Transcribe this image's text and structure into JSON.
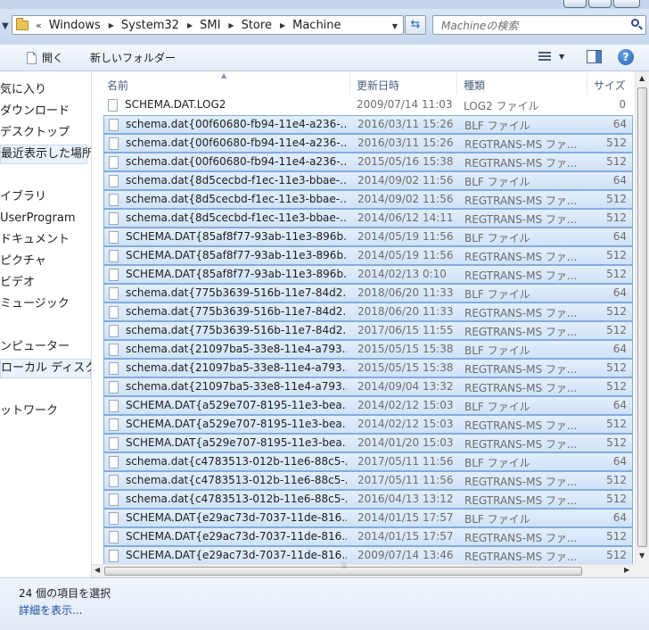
{
  "address": {
    "more": "«",
    "crumbs": [
      "Windows",
      "System32",
      "SMI",
      "Store",
      "Machine"
    ]
  },
  "search": {
    "placeholder": "Machineの検索"
  },
  "toolbar": {
    "open_label": "開く",
    "new_folder_label": "新しいフォルダー"
  },
  "nav": {
    "items": [
      "気に入り",
      "ダウンロード",
      "デスクトップ",
      "最近表示した場所",
      "イブラリ",
      "UserProgram",
      "ドキュメント",
      "ピクチャ",
      "ビデオ",
      "ミュージック",
      "ンピューター",
      "ローカル ディスク (",
      "ットワーク"
    ]
  },
  "columns": {
    "name": "名前",
    "date": "更新日時",
    "type": "種類",
    "size": "サイズ"
  },
  "files": [
    {
      "name": "SCHEMA.DAT.LOG2",
      "date": "2009/07/14 11:03",
      "type": "LOG2 ファイル",
      "size": "0",
      "selected": false
    },
    {
      "name": "schema.dat{00f60680-fb94-11e4-a236-...",
      "date": "2016/03/11 15:26",
      "type": "BLF ファイル",
      "size": "64",
      "selected": true
    },
    {
      "name": "schema.dat{00f60680-fb94-11e4-a236-...",
      "date": "2016/03/11 15:26",
      "type": "REGTRANS-MS ファ...",
      "size": "512",
      "selected": true
    },
    {
      "name": "schema.dat{00f60680-fb94-11e4-a236-...",
      "date": "2015/05/16 15:38",
      "type": "REGTRANS-MS ファ...",
      "size": "512",
      "selected": true
    },
    {
      "name": "schema.dat{8d5cecbd-f1ec-11e3-bbae-...",
      "date": "2014/09/02 11:56",
      "type": "BLF ファイル",
      "size": "64",
      "selected": true
    },
    {
      "name": "schema.dat{8d5cecbd-f1ec-11e3-bbae-...",
      "date": "2014/09/02 11:56",
      "type": "REGTRANS-MS ファ...",
      "size": "512",
      "selected": true
    },
    {
      "name": "schema.dat{8d5cecbd-f1ec-11e3-bbae-...",
      "date": "2014/06/12 14:11",
      "type": "REGTRANS-MS ファ...",
      "size": "512",
      "selected": true
    },
    {
      "name": "SCHEMA.DAT{85af8f77-93ab-11e3-896b...",
      "date": "2014/05/19 11:56",
      "type": "BLF ファイル",
      "size": "64",
      "selected": true
    },
    {
      "name": "SCHEMA.DAT{85af8f77-93ab-11e3-896b...",
      "date": "2014/05/19 11:56",
      "type": "REGTRANS-MS ファ...",
      "size": "512",
      "selected": true
    },
    {
      "name": "SCHEMA.DAT{85af8f77-93ab-11e3-896b...",
      "date": "2014/02/13 0:10",
      "type": "REGTRANS-MS ファ...",
      "size": "512",
      "selected": true
    },
    {
      "name": "schema.dat{775b3639-516b-11e7-84d2...",
      "date": "2018/06/20 11:33",
      "type": "BLF ファイル",
      "size": "64",
      "selected": true
    },
    {
      "name": "schema.dat{775b3639-516b-11e7-84d2...",
      "date": "2018/06/20 11:33",
      "type": "REGTRANS-MS ファ...",
      "size": "512",
      "selected": true
    },
    {
      "name": "schema.dat{775b3639-516b-11e7-84d2...",
      "date": "2017/06/15 11:55",
      "type": "REGTRANS-MS ファ...",
      "size": "512",
      "selected": true
    },
    {
      "name": "schema.dat{21097ba5-33e8-11e4-a793...",
      "date": "2015/05/15 15:38",
      "type": "BLF ファイル",
      "size": "64",
      "selected": true
    },
    {
      "name": "schema.dat{21097ba5-33e8-11e4-a793...",
      "date": "2015/05/15 15:38",
      "type": "REGTRANS-MS ファ...",
      "size": "512",
      "selected": true
    },
    {
      "name": "schema.dat{21097ba5-33e8-11e4-a793...",
      "date": "2014/09/04 13:32",
      "type": "REGTRANS-MS ファ...",
      "size": "512",
      "selected": true
    },
    {
      "name": "SCHEMA.DAT{a529e707-8195-11e3-bea...",
      "date": "2014/02/12 15:03",
      "type": "BLF ファイル",
      "size": "64",
      "selected": true
    },
    {
      "name": "SCHEMA.DAT{a529e707-8195-11e3-bea...",
      "date": "2014/02/12 15:03",
      "type": "REGTRANS-MS ファ...",
      "size": "512",
      "selected": true
    },
    {
      "name": "SCHEMA.DAT{a529e707-8195-11e3-bea...",
      "date": "2014/01/20 15:03",
      "type": "REGTRANS-MS ファ...",
      "size": "512",
      "selected": true
    },
    {
      "name": "schema.dat{c4783513-012b-11e6-88c5-...",
      "date": "2017/05/11 11:56",
      "type": "BLF ファイル",
      "size": "64",
      "selected": true
    },
    {
      "name": "schema.dat{c4783513-012b-11e6-88c5-...",
      "date": "2017/05/11 11:56",
      "type": "REGTRANS-MS ファ...",
      "size": "512",
      "selected": true
    },
    {
      "name": "schema.dat{c4783513-012b-11e6-88c5-...",
      "date": "2016/04/13 13:12",
      "type": "REGTRANS-MS ファ...",
      "size": "512",
      "selected": true
    },
    {
      "name": "SCHEMA.DAT{e29ac73d-7037-11de-816...",
      "date": "2014/01/15 17:57",
      "type": "BLF ファイル",
      "size": "64",
      "selected": true
    },
    {
      "name": "SCHEMA.DAT{e29ac73d-7037-11de-816...",
      "date": "2014/01/15 17:57",
      "type": "REGTRANS-MS ファ...",
      "size": "512",
      "selected": true
    },
    {
      "name": "SCHEMA.DAT{e29ac73d-7037-11de-816...",
      "date": "2009/07/14 13:46",
      "type": "REGTRANS-MS ファ...",
      "size": "512",
      "selected": true
    }
  ],
  "status": {
    "selection": "24 個の項目を選択",
    "details_link": "詳細を表示..."
  },
  "icons": {
    "back": "back-arrow-icon",
    "folder": "folder-icon",
    "refresh": "refresh-icon",
    "search": "search-icon",
    "open": "document-icon",
    "views": "view-options-icon",
    "preview": "preview-pane-icon",
    "help": "help-icon",
    "file": "file-icon"
  },
  "colors": {
    "selection_bg": "#cfe2f8",
    "selection_border": "#84acdd",
    "link": "#1e50a2",
    "chrome": "#c6d7ec"
  }
}
